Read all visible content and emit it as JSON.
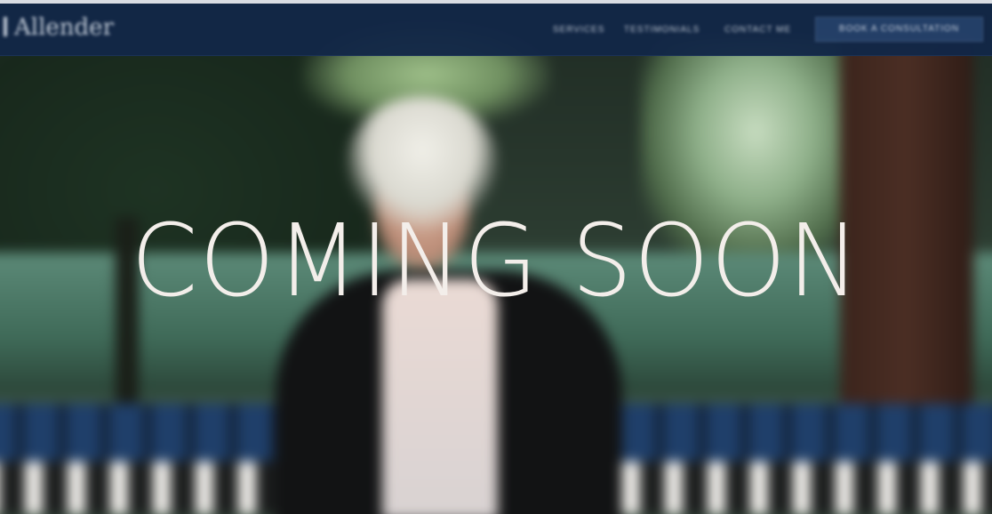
{
  "brand": {
    "name": "Allender"
  },
  "nav": {
    "links": [
      "SERVICES",
      "TESTIMONIALS",
      "CONTACT ME"
    ],
    "cta_label": "BOOK A CONSULTATION"
  },
  "hero": {
    "headline": "COMING SOON"
  },
  "colors": {
    "navbar": "#122747",
    "headline": "#f3eeea",
    "cta": "#24406a"
  }
}
